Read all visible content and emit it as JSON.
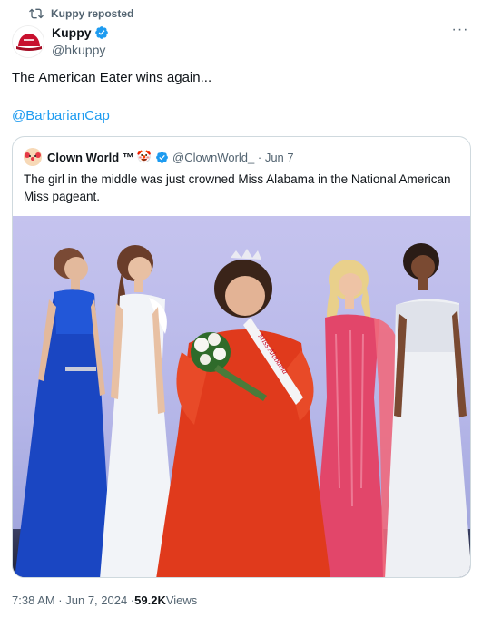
{
  "repost": {
    "label": "Kuppy reposted"
  },
  "author": {
    "name": "Kuppy",
    "handle": "@hkuppy"
  },
  "more_label": "···",
  "tweet": {
    "text": "The American Eater wins again...",
    "link": "@BarbarianCap"
  },
  "quoted": {
    "name": "Clown World ™",
    "emoji": "🤡",
    "meta": "@ClownWorld_ · Jun 7",
    "text": "The girl in the middle was just crowned Miss Alabama in the National American Miss pageant.",
    "sash_text": "Miss Alabama"
  },
  "footer": {
    "time": "7:38 AM · Jun 7, 2024 · ",
    "views_count": "59.2K",
    "views_label": " Views"
  },
  "colors": {
    "accent": "#1d9bf0",
    "secondary_text": "#536471",
    "border": "#cfd9de"
  },
  "icons": [
    "repost-icon",
    "verified-badge-icon",
    "more-icon",
    "red-cap-avatar",
    "clown-avatar"
  ]
}
